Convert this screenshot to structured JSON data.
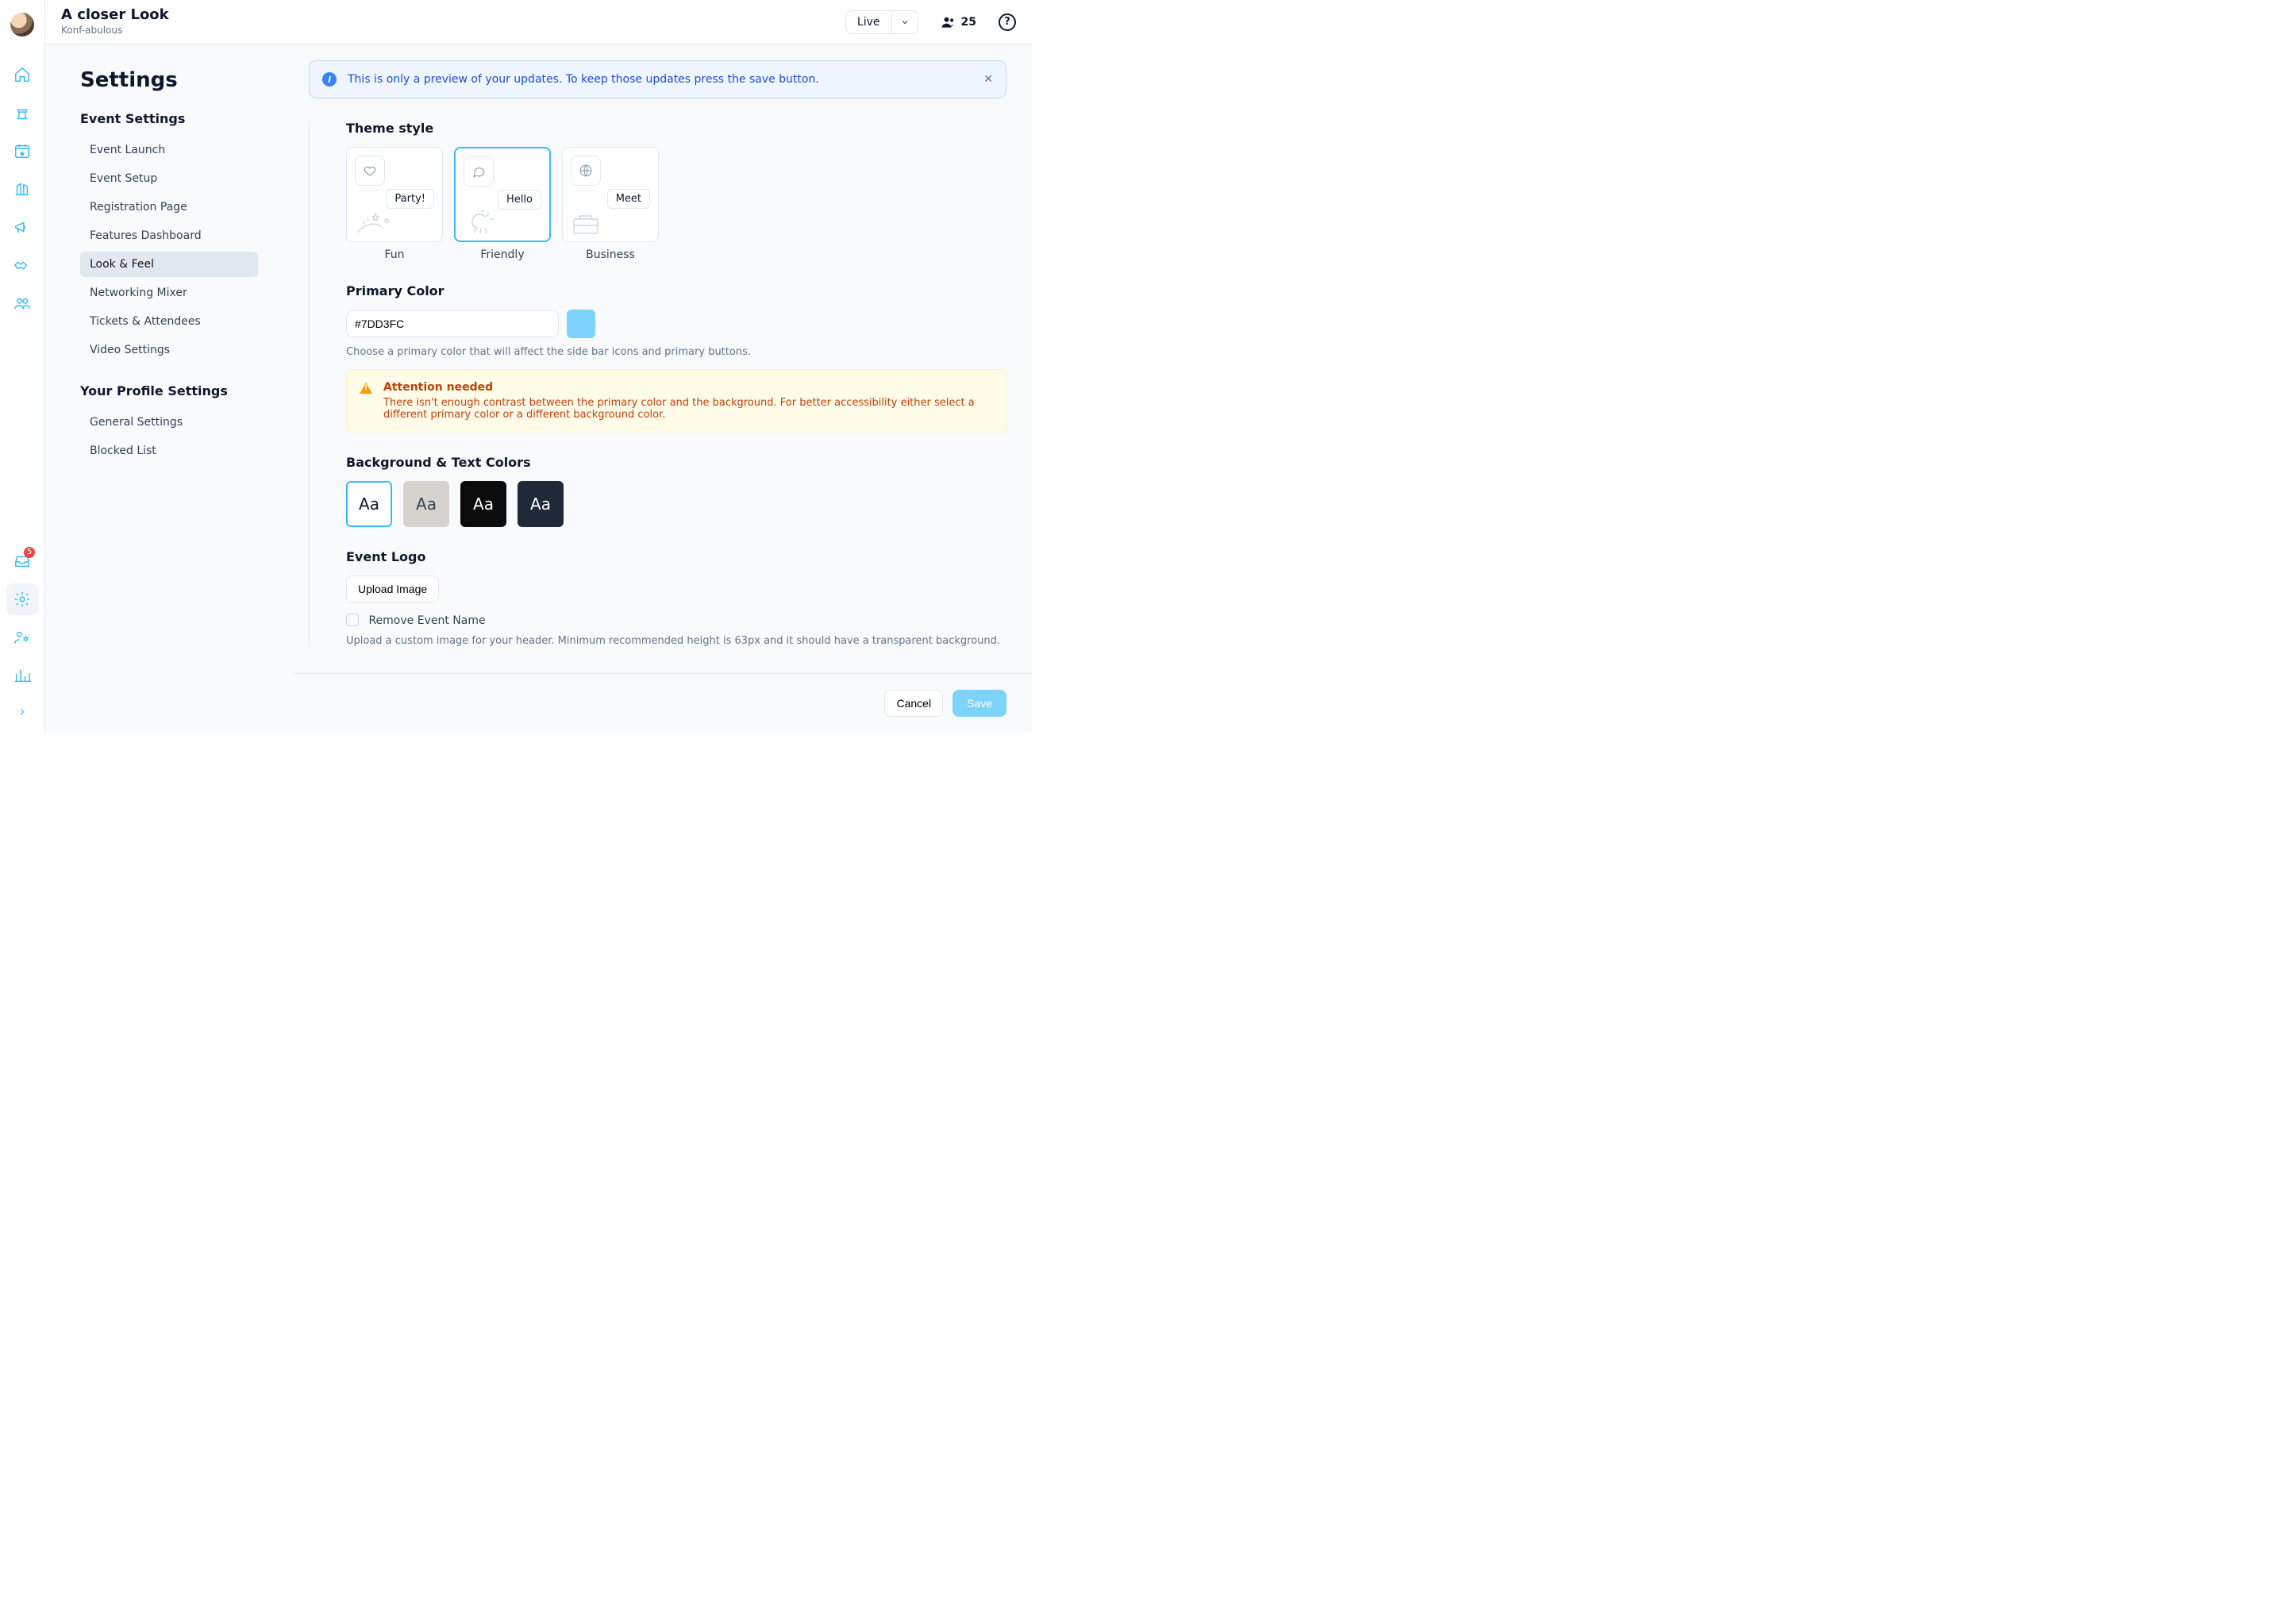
{
  "header": {
    "title": "A closer Look",
    "subtitle": "Konf-abulous",
    "live_label": "Live",
    "attendees_count": "25",
    "help_symbol": "?"
  },
  "rail": {
    "inbox_badge": "5"
  },
  "banner": {
    "text": "This is only a preview of your updates. To keep those updates press the save button.",
    "info_symbol": "i",
    "close_symbol": "✕"
  },
  "page": {
    "heading": "Settings"
  },
  "nav": {
    "event_section_title": "Event Settings",
    "event_items": [
      "Event Launch",
      "Event Setup",
      "Registration Page",
      "Features Dashboard",
      "Look & Feel",
      "Networking Mixer",
      "Tickets & Attendees",
      "Video Settings"
    ],
    "profile_section_title": "Your Profile Settings",
    "profile_items": [
      "General Settings",
      "Blocked List"
    ]
  },
  "theme": {
    "heading": "Theme style",
    "options": [
      {
        "label": "Fun",
        "pill": "Party!"
      },
      {
        "label": "Friendly",
        "pill": "Hello"
      },
      {
        "label": "Business",
        "pill": "Meet"
      }
    ]
  },
  "primary_color": {
    "heading": "Primary Color",
    "value": "#7DD3FC",
    "help": "Choose a primary color that will affect the side bar icons and primary buttons.",
    "warning_title": "Attention needed",
    "warning_body": "There isn't enough contrast between the primary color and the background. For better accessibility either select a different primary color or a different background color."
  },
  "bg_text": {
    "heading": "Background & Text Colors",
    "sample": "Aa",
    "tiles": [
      {
        "bg": "#FFFFFF",
        "fg": "#0F172A",
        "selected": true
      },
      {
        "bg": "#D6D3CE",
        "fg": "#374151",
        "selected": false
      },
      {
        "bg": "#0B0B0C",
        "fg": "#FFFFFF",
        "selected": false
      },
      {
        "bg": "#1F2937",
        "fg": "#FFFFFF",
        "selected": false
      }
    ]
  },
  "logo": {
    "heading": "Event Logo",
    "upload_label": "Upload Image",
    "remove_label": "Remove Event Name",
    "help": "Upload a custom image for your header. Minimum recommended height is 63px and it should have a transparent background."
  },
  "footer": {
    "cancel": "Cancel",
    "save": "Save"
  }
}
